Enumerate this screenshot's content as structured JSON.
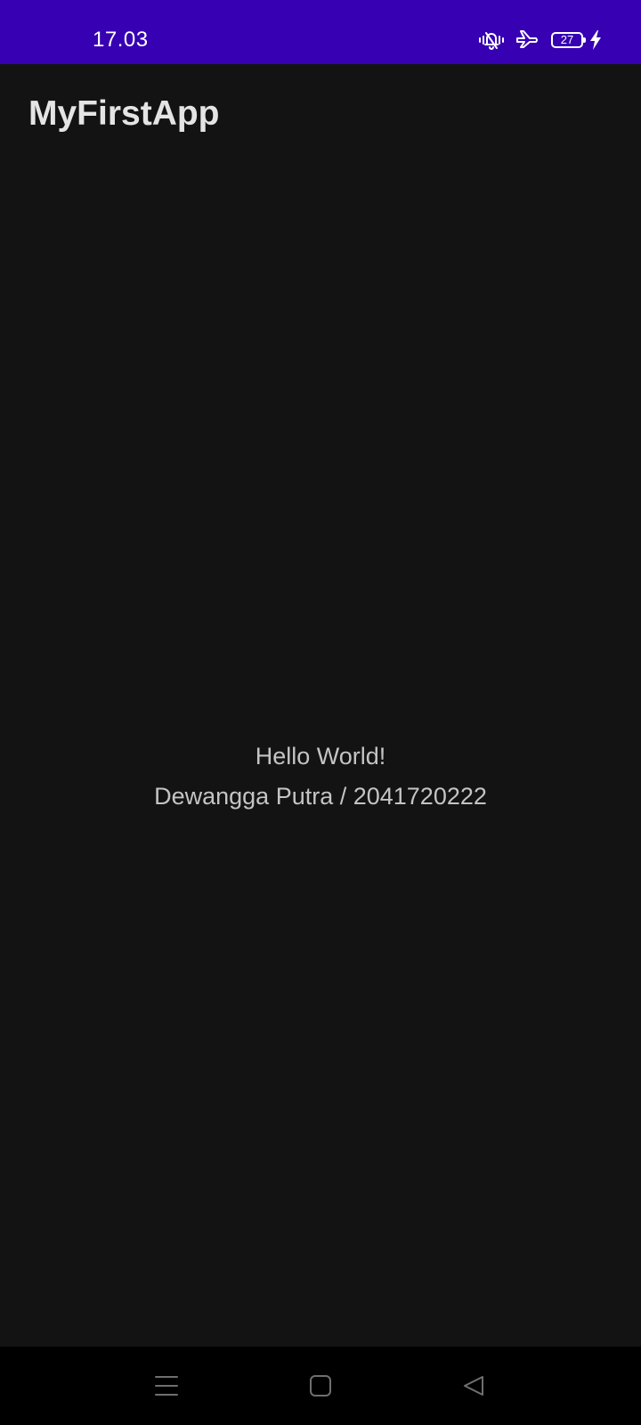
{
  "status_bar": {
    "time": "17.03",
    "battery_level": "27",
    "background_color": "#3700b3",
    "icons": [
      "vibrate-mute-icon",
      "airplane-mode-icon",
      "battery-icon",
      "charging-bolt-icon"
    ]
  },
  "app_bar": {
    "title": "MyFirstApp"
  },
  "main": {
    "hello_text": "Hello World!",
    "name_id_text": "Dewangga Putra / 2041720222"
  },
  "nav_bar": {
    "buttons": [
      "recent-apps-icon",
      "home-icon",
      "back-icon"
    ]
  }
}
